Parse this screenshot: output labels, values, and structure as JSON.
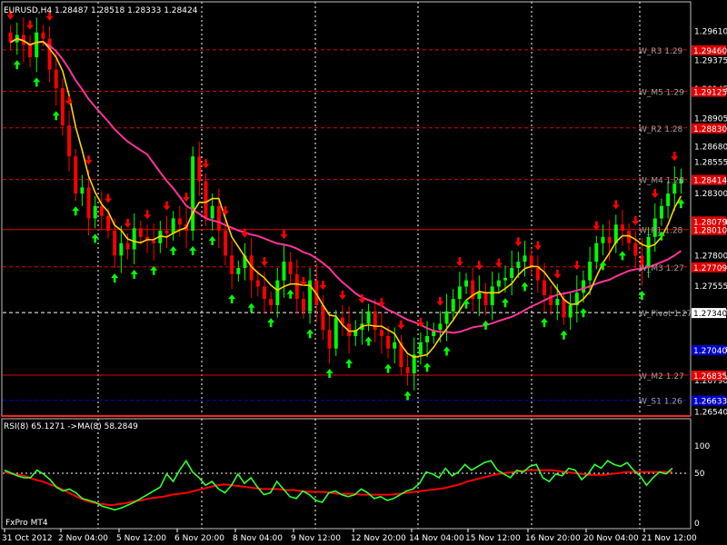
{
  "main": {
    "header": "EURUSD,H4  1.28487 1.28518 1.28333 1.28424",
    "price_ticks": [
      "1.29610",
      "1.29375",
      "1.29145",
      "1.28905",
      "1.28680",
      "1.28555",
      "1.28300",
      "1.28070",
      "1.27800",
      "1.27555",
      "1.27340",
      "1.27040",
      "1.26790",
      "1.26540"
    ],
    "level_tags": [
      {
        "value": "1.29460",
        "bg": "#e00000"
      },
      {
        "value": "1.29125",
        "bg": "#e00000"
      },
      {
        "value": "1.28830",
        "bg": "#e00000"
      },
      {
        "value": "1.28414",
        "bg": "#e00000"
      },
      {
        "value": "1.28079",
        "bg": "#e00000"
      },
      {
        "value": "1.28010",
        "bg": "#e00000"
      },
      {
        "value": "1.27709",
        "bg": "#e00000"
      },
      {
        "value": "1.27340",
        "bg": "#ffffff"
      },
      {
        "value": "1.27040",
        "bg": "#0000cc"
      },
      {
        "value": "1.26835",
        "bg": "#e00000"
      },
      {
        "value": "1.26633",
        "bg": "#0000cc"
      }
    ],
    "level_labels": [
      "W_R3 1.29",
      "W_M5 1.29",
      "W_R2 1.28",
      "W_M4 1.28",
      "W_R1 1.28",
      "W_M3 1.27",
      "W_Pivot 1.27",
      "W_M2 1.27",
      "W_S1 1.26"
    ]
  },
  "rsi": {
    "header": "RSI(8) 65.1271  ->MA(8) 58.2849",
    "ticks": [
      "100",
      "50",
      "0"
    ],
    "broker": "FxPro MT4"
  },
  "x_labels": [
    "31 Oct 2012",
    "2 Nov 04:00",
    "5 Nov 12:00",
    "6 Nov 20:00",
    "8 Nov 04:00",
    "9 Nov 12:00",
    "12 Nov 20:00",
    "14 Nov 04:00",
    "15 Nov 12:00",
    "16 Nov 20:00",
    "20 Nov 04:00",
    "21 Nov 12:00"
  ],
  "chart_data": {
    "type": "candlestick",
    "symbol": "EURUSD",
    "timeframe": "H4",
    "last_bar": {
      "open": 1.28487,
      "high": 1.28518,
      "low": 1.28333,
      "close": 1.28424
    },
    "y_range": [
      1.2652,
      1.2973
    ],
    "close_prices": [
      1.2952,
      1.2958,
      1.295,
      1.294,
      1.296,
      1.2955,
      1.293,
      1.2915,
      1.2885,
      1.286,
      1.283,
      1.2835,
      1.281,
      1.282,
      1.2812,
      1.28,
      1.278,
      1.279,
      1.2785,
      1.2802,
      1.2795,
      1.2792,
      1.279,
      1.28,
      1.2798,
      1.281,
      1.2805,
      1.28,
      1.286,
      1.284,
      1.281,
      1.282,
      1.28,
      1.278,
      1.2765,
      1.277,
      1.278,
      1.276,
      1.2755,
      1.2745,
      1.274,
      1.276,
      1.2775,
      1.2765,
      1.2745,
      1.2735,
      1.276,
      1.274,
      1.272,
      1.2705,
      1.273,
      1.2725,
      1.2715,
      1.272,
      1.2725,
      1.2735,
      1.272,
      1.2715,
      1.2705,
      1.271,
      1.269,
      1.2685,
      1.27,
      1.271,
      1.2715,
      1.272,
      1.2725,
      1.2735,
      1.2745,
      1.2755,
      1.276,
      1.2745,
      1.275,
      1.274,
      1.2755,
      1.276,
      1.2762,
      1.277,
      1.2775,
      1.278,
      1.277,
      1.276,
      1.2748,
      1.274,
      1.2745,
      1.273,
      1.274,
      1.275,
      1.276,
      1.2775,
      1.279,
      1.2795,
      1.279,
      1.2805,
      1.28,
      1.279,
      1.278,
      1.277,
      1.2795,
      1.281,
      1.282,
      1.283,
      1.2838,
      1.2842
    ],
    "levels": [
      {
        "name": "W_R3",
        "value": 1.2946,
        "color": "#e00000",
        "style": "dashed"
      },
      {
        "name": "W_M5",
        "value": 1.29125,
        "color": "#e00000",
        "style": "dashed"
      },
      {
        "name": "W_R2",
        "value": 1.2883,
        "color": "#e00000",
        "style": "dashed"
      },
      {
        "name": "W_M4",
        "value": 1.28414,
        "color": "#e00000",
        "style": "dashed"
      },
      {
        "name": "W_R1",
        "value": 1.2801,
        "color": "#e00000",
        "style": "solid"
      },
      {
        "name": "W_M3",
        "value": 1.27709,
        "color": "#e00000",
        "style": "dashed"
      },
      {
        "name": "W_Pivot",
        "value": 1.2734,
        "color": "#ffffff",
        "style": "dashed"
      },
      {
        "name": "W_M2",
        "value": 1.26835,
        "color": "#e00000",
        "style": "solid"
      },
      {
        "name": "W_S1",
        "value": 1.26633,
        "color": "#0000cc",
        "style": "dashed"
      }
    ],
    "fast_ma_color": "#ffd400",
    "slow_ma_color": "#ff3399",
    "rsi_values": [
      60,
      57,
      54,
      52,
      52,
      60,
      56,
      50,
      42,
      38,
      40,
      36,
      30,
      28,
      26,
      22,
      20,
      18,
      20,
      23,
      26,
      30,
      34,
      38,
      42,
      56,
      48,
      60,
      70,
      58,
      52,
      44,
      48,
      40,
      36,
      44,
      56,
      46,
      52,
      42,
      34,
      36,
      48,
      40,
      32,
      30,
      38,
      34,
      28,
      26,
      36,
      38,
      34,
      32,
      34,
      40,
      36,
      30,
      32,
      28,
      30,
      34,
      38,
      40,
      46,
      58,
      56,
      52,
      62,
      54,
      58,
      66,
      60,
      64,
      68,
      70,
      60,
      56,
      52,
      60,
      58,
      64,
      66,
      52,
      48,
      56,
      54,
      62,
      60,
      50,
      56,
      66,
      62,
      70,
      66,
      64,
      68,
      60,
      54,
      44,
      52,
      58,
      56,
      62
    ],
    "rsi_ma_values": [
      58,
      56,
      55,
      53,
      50,
      48,
      45,
      42,
      38,
      34,
      30,
      27,
      25,
      24,
      23,
      24,
      25,
      27,
      28,
      30,
      31,
      32,
      34,
      35,
      36,
      38,
      40,
      42,
      44,
      45,
      44,
      43,
      42,
      41,
      40,
      40,
      40,
      39,
      39,
      38,
      37,
      37,
      37,
      36,
      35,
      35,
      35,
      34,
      34,
      34,
      34,
      34,
      35,
      36,
      37,
      38,
      39,
      40,
      41,
      43,
      45,
      48,
      50,
      52,
      54,
      56,
      57,
      58,
      59,
      60,
      60,
      60,
      60,
      59,
      58,
      57,
      56,
      55,
      55,
      55,
      56,
      57,
      58,
      58,
      58,
      58,
      58,
      58,
      58
    ]
  }
}
